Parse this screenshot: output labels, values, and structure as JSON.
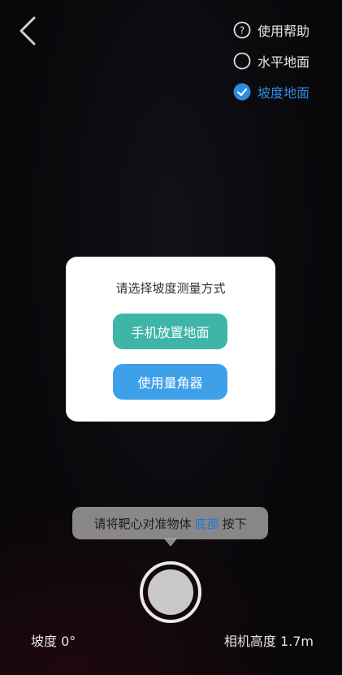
{
  "top_menu": {
    "help_label": "使用帮助",
    "horizontal_label": "水平地面",
    "slope_label": "坡度地面",
    "selected": "坡度地面"
  },
  "dialog": {
    "title": "请选择坡度测量方式",
    "option_phone": "手机放置地面",
    "option_protractor": "使用量角器"
  },
  "hint": {
    "prefix": "请将靶心对准物体",
    "highlight": "底部",
    "suffix": "按下"
  },
  "readouts": {
    "slope_label": "坡度",
    "slope_value": "0°",
    "camera_height_label": "相机高度",
    "camera_height_value": "1.7m"
  },
  "colors": {
    "accent_blue": "#2d8be0",
    "teal_button": "#3eb5a6",
    "blue_button": "#3fa0ea"
  },
  "icons": {
    "back": "chevron-left",
    "help": "question-circle",
    "radio_off": "circle-outline",
    "radio_on": "check-circle"
  }
}
